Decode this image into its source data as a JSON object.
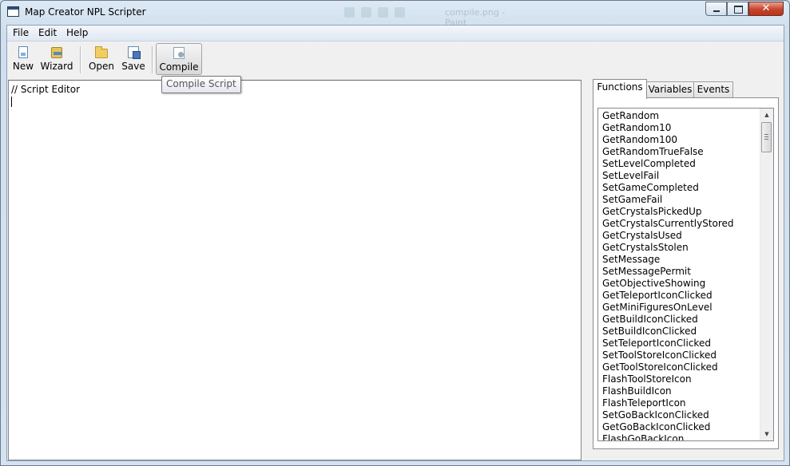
{
  "window": {
    "title": "Map Creator NPL Scripter",
    "background_ghost_text": "compile.png - Paint",
    "caption_buttons": {
      "minimize_icon": "minimize-icon",
      "maximize_icon": "maximize-icon",
      "close_glyph": "✕"
    }
  },
  "menu": {
    "items": [
      "File",
      "Edit",
      "Help"
    ]
  },
  "toolbar": {
    "buttons": [
      {
        "label": "New",
        "icon": "new-document-icon"
      },
      {
        "label": "Wizard",
        "icon": "wizard-icon"
      },
      {
        "label": "Open",
        "icon": "open-folder-icon"
      },
      {
        "label": "Save",
        "icon": "save-icon"
      },
      {
        "label": "Compile",
        "icon": "compile-icon",
        "state": "hovered"
      }
    ],
    "tooltip": "Compile Script"
  },
  "editor": {
    "content": "// Script Editor"
  },
  "side_panel": {
    "tabs": [
      "Functions",
      "Variables",
      "Events"
    ],
    "active_tab": "Functions",
    "functions": [
      "GetRandom",
      "GetRandom10",
      "GetRandom100",
      "GetRandomTrueFalse",
      "SetLevelCompleted",
      "SetLevelFail",
      "SetGameCompleted",
      "SetGameFail",
      "GetCrystalsPickedUp",
      "GetCrystalsCurrentlyStored",
      "GetCrystalsUsed",
      "GetCrystalsStolen",
      "SetMessage",
      "SetMessagePermit",
      "GetObjectiveShowing",
      "GetTeleportIconClicked",
      "GetMiniFiguresOnLevel",
      "GetBuildIconClicked",
      "SetBuildIconClicked",
      "SetTeleportIconClicked",
      "SetToolStoreIconClicked",
      "GetToolStoreIconClicked",
      "FlashToolStoreIcon",
      "FlashBuildIcon",
      "FlashTeleportIcon",
      "SetGoBackIconClicked",
      "GetGoBackIconClicked",
      "FlashGoBackIcon"
    ],
    "scrollbar": {
      "up_glyph": "▲",
      "down_glyph": "▼"
    }
  },
  "colors": {
    "title_bar": "#d5e3f0",
    "close_button": "#c7432b",
    "editor_bg": "#ffffff"
  }
}
